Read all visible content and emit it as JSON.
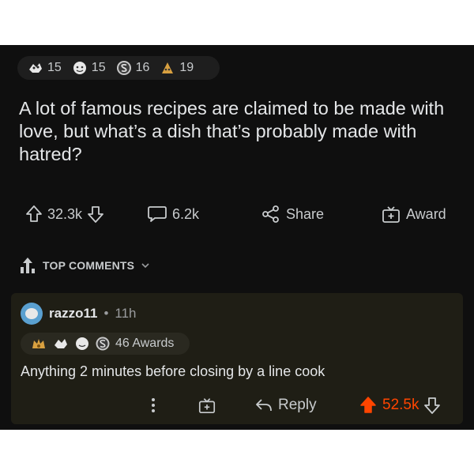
{
  "post": {
    "awards": [
      {
        "icon": "wholesome-award-icon",
        "count": "15"
      },
      {
        "icon": "hugz-award-icon",
        "count": "15"
      },
      {
        "icon": "silver-award-icon",
        "count": "16"
      },
      {
        "icon": "helpful-award-icon",
        "count": "19"
      }
    ],
    "title": "A lot of famous recipes are claimed to be made with love, but what’s a dish that’s probably made with hatred?",
    "actions": {
      "upvotes": "32.3k",
      "comments": "6.2k",
      "share_label": "Share",
      "award_label": "Award"
    }
  },
  "comments_header": {
    "label": "TOP COMMENTS"
  },
  "comment": {
    "username": "razzo11",
    "separator": "•",
    "age": "11h",
    "awards_label": "46 Awards",
    "body": "Anything 2 minutes before closing by a line cook",
    "reply_label": "Reply",
    "score": "52.5k"
  },
  "colors": {
    "background": "#0f0f0f",
    "comment_bg": "#1f1e15",
    "upvote_accent": "#ff4500",
    "text": "#d7dadc"
  }
}
